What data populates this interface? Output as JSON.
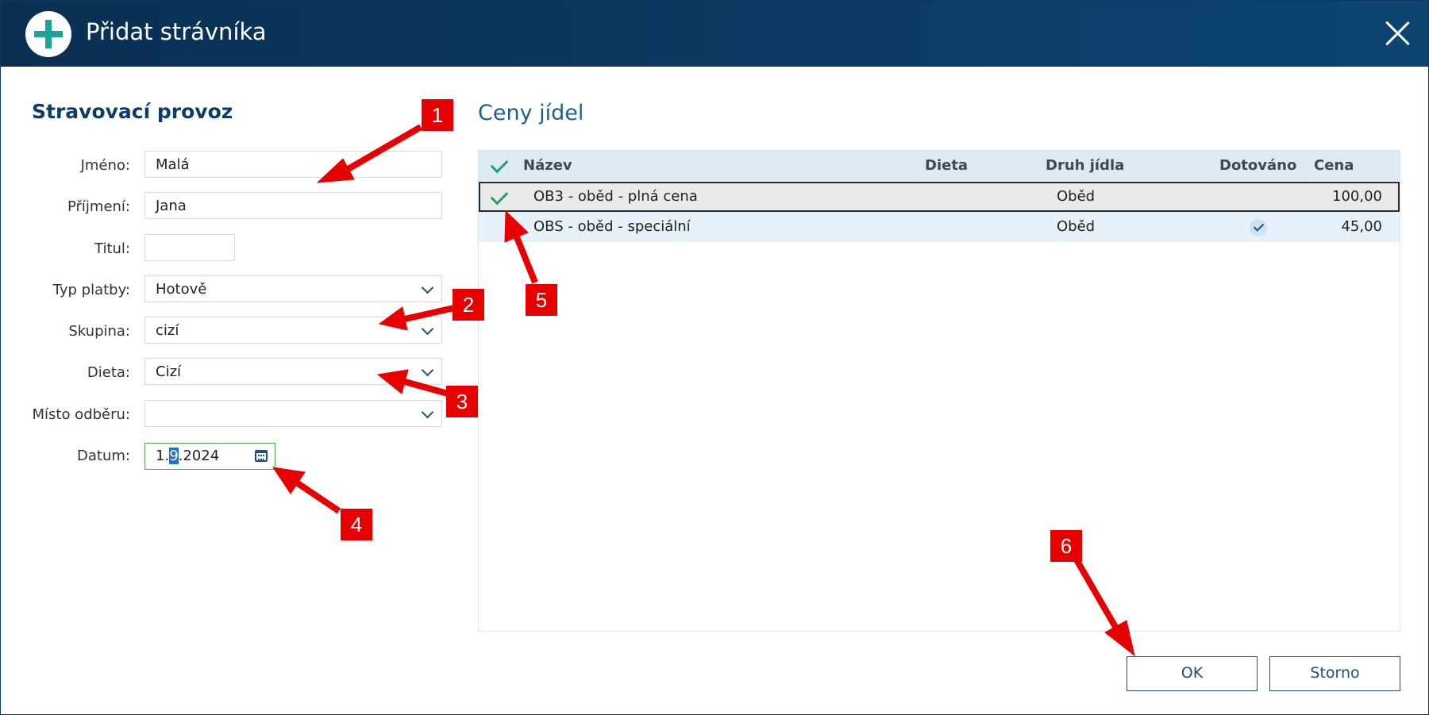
{
  "window": {
    "title": "Přidat strávníka",
    "close_icon": "close-icon",
    "title_icon": "plus-circle-icon"
  },
  "form": {
    "section_title": "Stravovací provoz",
    "fields": {
      "jmeno": {
        "label": "Jméno:",
        "value": "Malá"
      },
      "prijmeni": {
        "label": "Příjmení:",
        "value": "Jana"
      },
      "titul": {
        "label": "Titul:",
        "value": ""
      },
      "typ_platby": {
        "label": "Typ platby:",
        "value": "Hotově"
      },
      "skupina": {
        "label": "Skupina:",
        "value": "cizí"
      },
      "dieta": {
        "label": "Dieta:",
        "value": "Cizí"
      },
      "misto_odberu": {
        "label": "Místo odběru:",
        "value": ""
      },
      "datum": {
        "label": "Datum:",
        "value_pre": "1.",
        "value_selected": "9",
        "value_post": ".2024"
      }
    }
  },
  "prices": {
    "title": "Ceny jídel",
    "columns": [
      "Název",
      "Dieta",
      "Druh jídla",
      "Dotováno",
      "Cena"
    ],
    "rows": [
      {
        "checked": true,
        "nazev": "OB3 - oběd - plná cena",
        "dieta": "",
        "druh": "Oběd",
        "dotovano": false,
        "cena": "100,00",
        "selected": true
      },
      {
        "checked": false,
        "nazev": "OBS - oběd - speciální",
        "dieta": "",
        "druh": "Oběd",
        "dotovano": true,
        "cena": "45,00",
        "selected": false
      }
    ]
  },
  "buttons": {
    "ok": "OK",
    "storno": "Storno"
  },
  "annotations": [
    "1",
    "2",
    "3",
    "4",
    "5",
    "6"
  ],
  "colors": {
    "titlebar": "#0a2f52",
    "accent": "#1d4f7a",
    "badge": "#e60000",
    "check": "#22a06b"
  }
}
